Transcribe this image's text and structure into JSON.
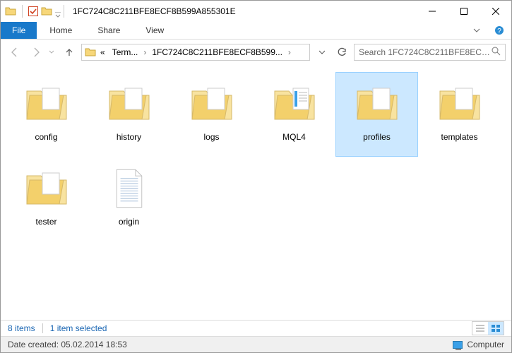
{
  "window": {
    "title": "1FC724C8C211BFE8ECF8B599A855301E"
  },
  "ribbon": {
    "file": "File",
    "tabs": [
      "Home",
      "Share",
      "View"
    ]
  },
  "breadcrumb": {
    "prefix": "«",
    "parts": [
      "Term...",
      "1FC724C8C211BFE8ECF8B599..."
    ]
  },
  "search": {
    "placeholder": "Search 1FC724C8C211BFE8ECF8B599..."
  },
  "items": [
    {
      "name": "config",
      "type": "folder",
      "selected": false
    },
    {
      "name": "history",
      "type": "folder",
      "selected": false
    },
    {
      "name": "logs",
      "type": "folder",
      "selected": false
    },
    {
      "name": "MQL4",
      "type": "folder-special",
      "selected": false
    },
    {
      "name": "profiles",
      "type": "folder",
      "selected": true
    },
    {
      "name": "templates",
      "type": "folder",
      "selected": false
    },
    {
      "name": "tester",
      "type": "folder",
      "selected": false
    },
    {
      "name": "origin",
      "type": "file",
      "selected": false
    }
  ],
  "status": {
    "count": "8 items",
    "selection": "1 item selected",
    "computer": "Computer"
  },
  "propbar": {
    "date": "Date created: 05.02.2014 18:53"
  },
  "icons": {
    "search": "search-icon",
    "refresh": "refresh-icon"
  }
}
